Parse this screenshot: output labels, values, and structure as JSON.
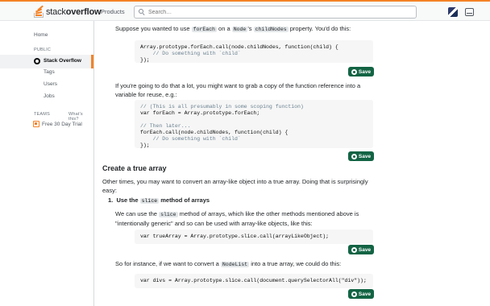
{
  "header": {
    "logo_text_light": "stack",
    "logo_text_bold": "overflow",
    "products_label": "Products",
    "search_placeholder": "Search…",
    "icons": {
      "search": "search-icon",
      "inbox": "inbox-icon"
    }
  },
  "sidebar": {
    "home_label": "Home",
    "public_section": "PUBLIC",
    "stack_overflow_label": "Stack Overflow",
    "tags_label": "Tags",
    "users_label": "Users",
    "jobs_label": "Jobs",
    "teams_section": "TEAMS",
    "whats_this_label": "What's this?",
    "trial_label": "Free 30 Day Trial"
  },
  "content": {
    "intro_before": "Suppose you wanted to use ",
    "intro_code1": "forEach",
    "intro_mid1": " on a ",
    "intro_code2": "Node",
    "intro_mid2": "'s ",
    "intro_code3": "childNodes",
    "intro_after": " property. You'd do this:",
    "code1": [
      "Array.prototype.forEach.call(node.childNodes, function(child) {",
      "    // Do something with `child`",
      "});"
    ],
    "para2": "If you're going to do that a lot, you might want to grab a copy of the function reference into a variable for reuse, e.g.:",
    "code2": [
      "// (This is all presumably in some scoping function)",
      "var forEach = Array.prototype.forEach;",
      "",
      "// Then later...",
      "forEach.call(node.childNodes, function(child) {",
      "    // Do something with `child`",
      "});"
    ],
    "heading": "Create a true array",
    "para3": "Other times, you may want to convert an array-like object into a true array. Doing that is surprisingly easy:",
    "li_number": "1.",
    "li_before": "Use the ",
    "li_code": "slice",
    "li_after": " method of arrays",
    "para4_before": "We can use the ",
    "para4_code": "slice",
    "para4_after": " method of arrays, which like the other methods mentioned above is \"intentionally generic\" and so can be used with array-like objects, like this:",
    "code3": "var trueArray = Array.prototype.slice.call(arrayLikeObject);",
    "para5_before": "So for instance, if we want to convert a ",
    "para5_code": "NodeList",
    "para5_after": " into a true array, we could do this:",
    "code4": "var divs = Array.prototype.slice.call(document.querySelectorAll(\"div\"));",
    "save_label": "Save"
  },
  "colors": {
    "accent": "#f48225",
    "save_button": "#136444"
  }
}
